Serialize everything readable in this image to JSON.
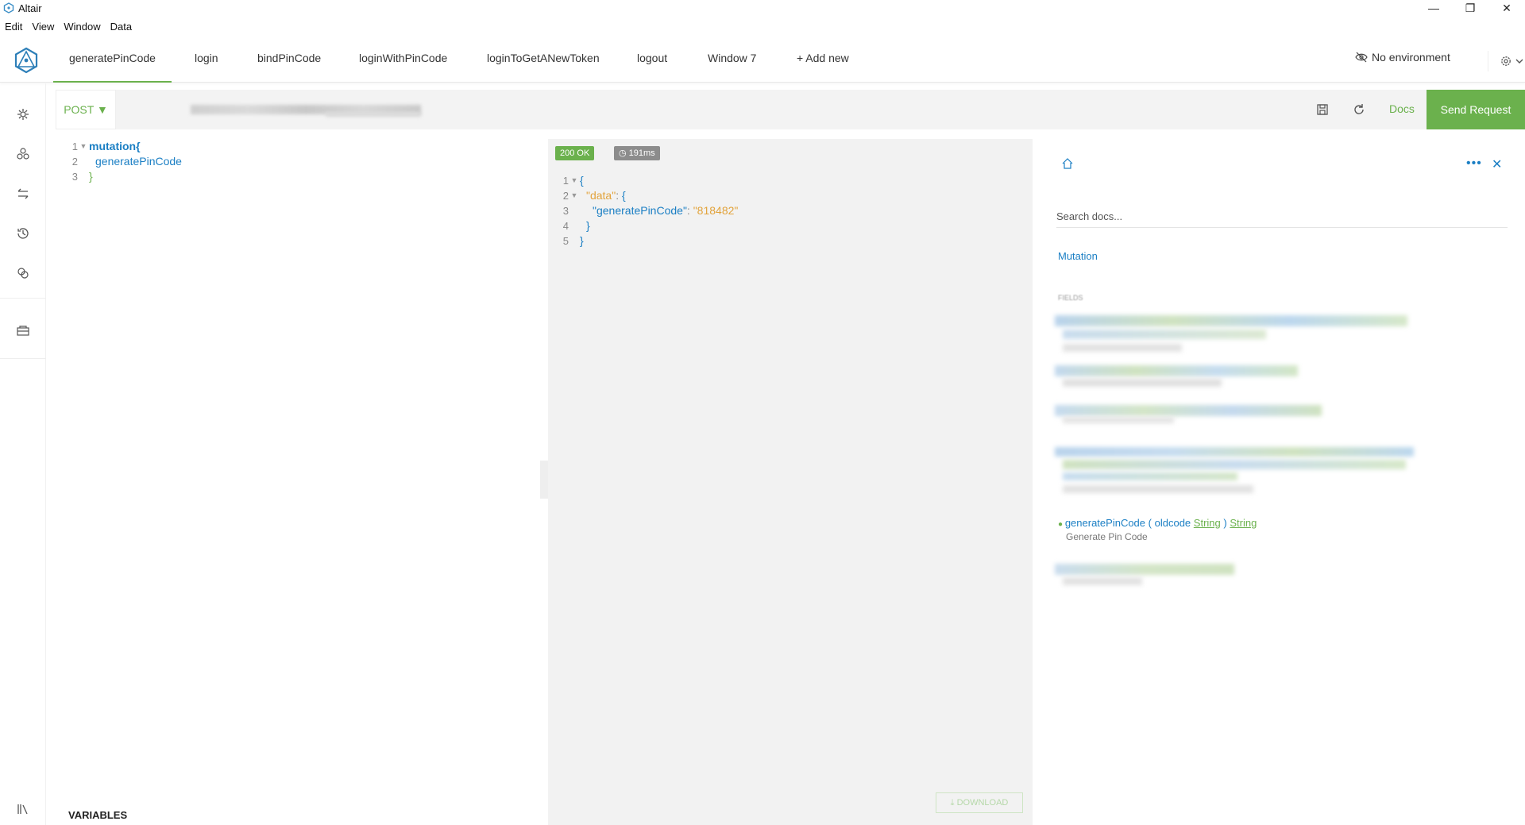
{
  "window": {
    "title": "Altair",
    "controls": {
      "minimize": "—",
      "restore": "❐",
      "close": "✕"
    }
  },
  "menu": [
    "Edit",
    "View",
    "Window",
    "Data"
  ],
  "tabs": [
    {
      "label": "generatePinCode",
      "active": true
    },
    {
      "label": "login"
    },
    {
      "label": "bindPinCode"
    },
    {
      "label": "loginWithPinCode"
    },
    {
      "label": "loginToGetANewToken"
    },
    {
      "label": "logout"
    },
    {
      "label": "Window 7"
    },
    {
      "label": "+ Add new"
    }
  ],
  "environment": {
    "label": "No environment"
  },
  "sidebar_icons": [
    "settings-icon",
    "schema-icon",
    "swap-icon",
    "history-icon",
    "plugins-icon",
    "collections-icon",
    "docs-icon"
  ],
  "request": {
    "method": "POST ▼",
    "docs_label": "Docs",
    "send_label": "Send Request"
  },
  "query": {
    "lines": [
      {
        "n": "1",
        "text": "mutation{"
      },
      {
        "n": "2",
        "text": "generatePinCode"
      },
      {
        "n": "3",
        "text": "}"
      }
    ],
    "variables_label": "VARIABLES"
  },
  "result": {
    "status": "200 OK",
    "time": "191ms",
    "line_numbers": [
      "1",
      "2",
      "3",
      "4",
      "5"
    ],
    "json": {
      "open": "{",
      "data_key": "\"data\"",
      "data_open": "{",
      "field_key": "\"generatePinCode\"",
      "field_value": "\"818482\"",
      "data_close": "}",
      "close": "}"
    },
    "download_label": "DOWNLOAD"
  },
  "docs": {
    "search_placeholder": "Search docs...",
    "type_link": "Mutation",
    "fields_label": "FIELDS",
    "field": {
      "name": "generatePinCode",
      "open_paren": "(",
      "arg_name": "oldcode",
      "arg_type": "String",
      "close_paren": ")",
      "return_type": "String",
      "description": "Generate Pin Code"
    }
  },
  "colors": {
    "accent": "#6bb14d",
    "link": "#1b7fc4",
    "string": "#e2a33b"
  }
}
